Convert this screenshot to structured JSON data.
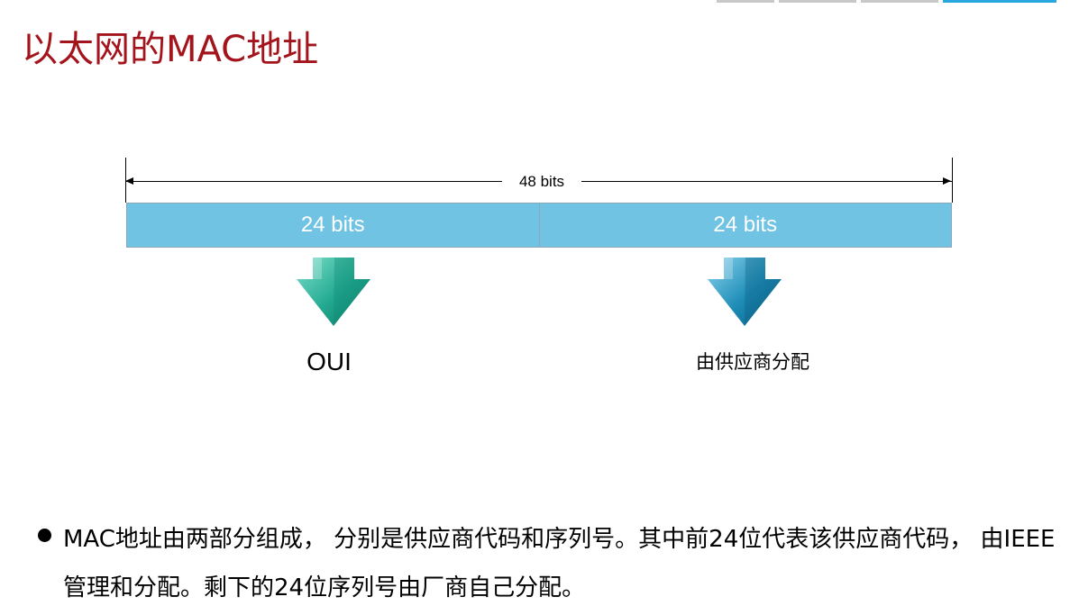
{
  "slide": {
    "title": "以太网的MAC地址"
  },
  "diagram": {
    "total_label": "48 bits",
    "fields": [
      {
        "label": "24 bits",
        "description": "OUI",
        "arrow_color": "#2bb39a"
      },
      {
        "label": "24 bits",
        "description": "由供应商分配",
        "arrow_color": "#1f8fb8"
      }
    ],
    "field_color": "#70c3e3"
  },
  "bullet": {
    "text": "MAC地址由两部分组成， 分别是供应商代码和序列号。其中前24位代表该供应商代码， 由IEEE管理和分配。剩下的24位序列号由厂商自己分配。"
  },
  "colors": {
    "title": "#a4141c",
    "deco_gray": "#c8c8c8",
    "deco_blue": "#29a8e0"
  },
  "icons": [
    "down-arrow-icon",
    "down-arrow-icon",
    "bullet-icon"
  ]
}
